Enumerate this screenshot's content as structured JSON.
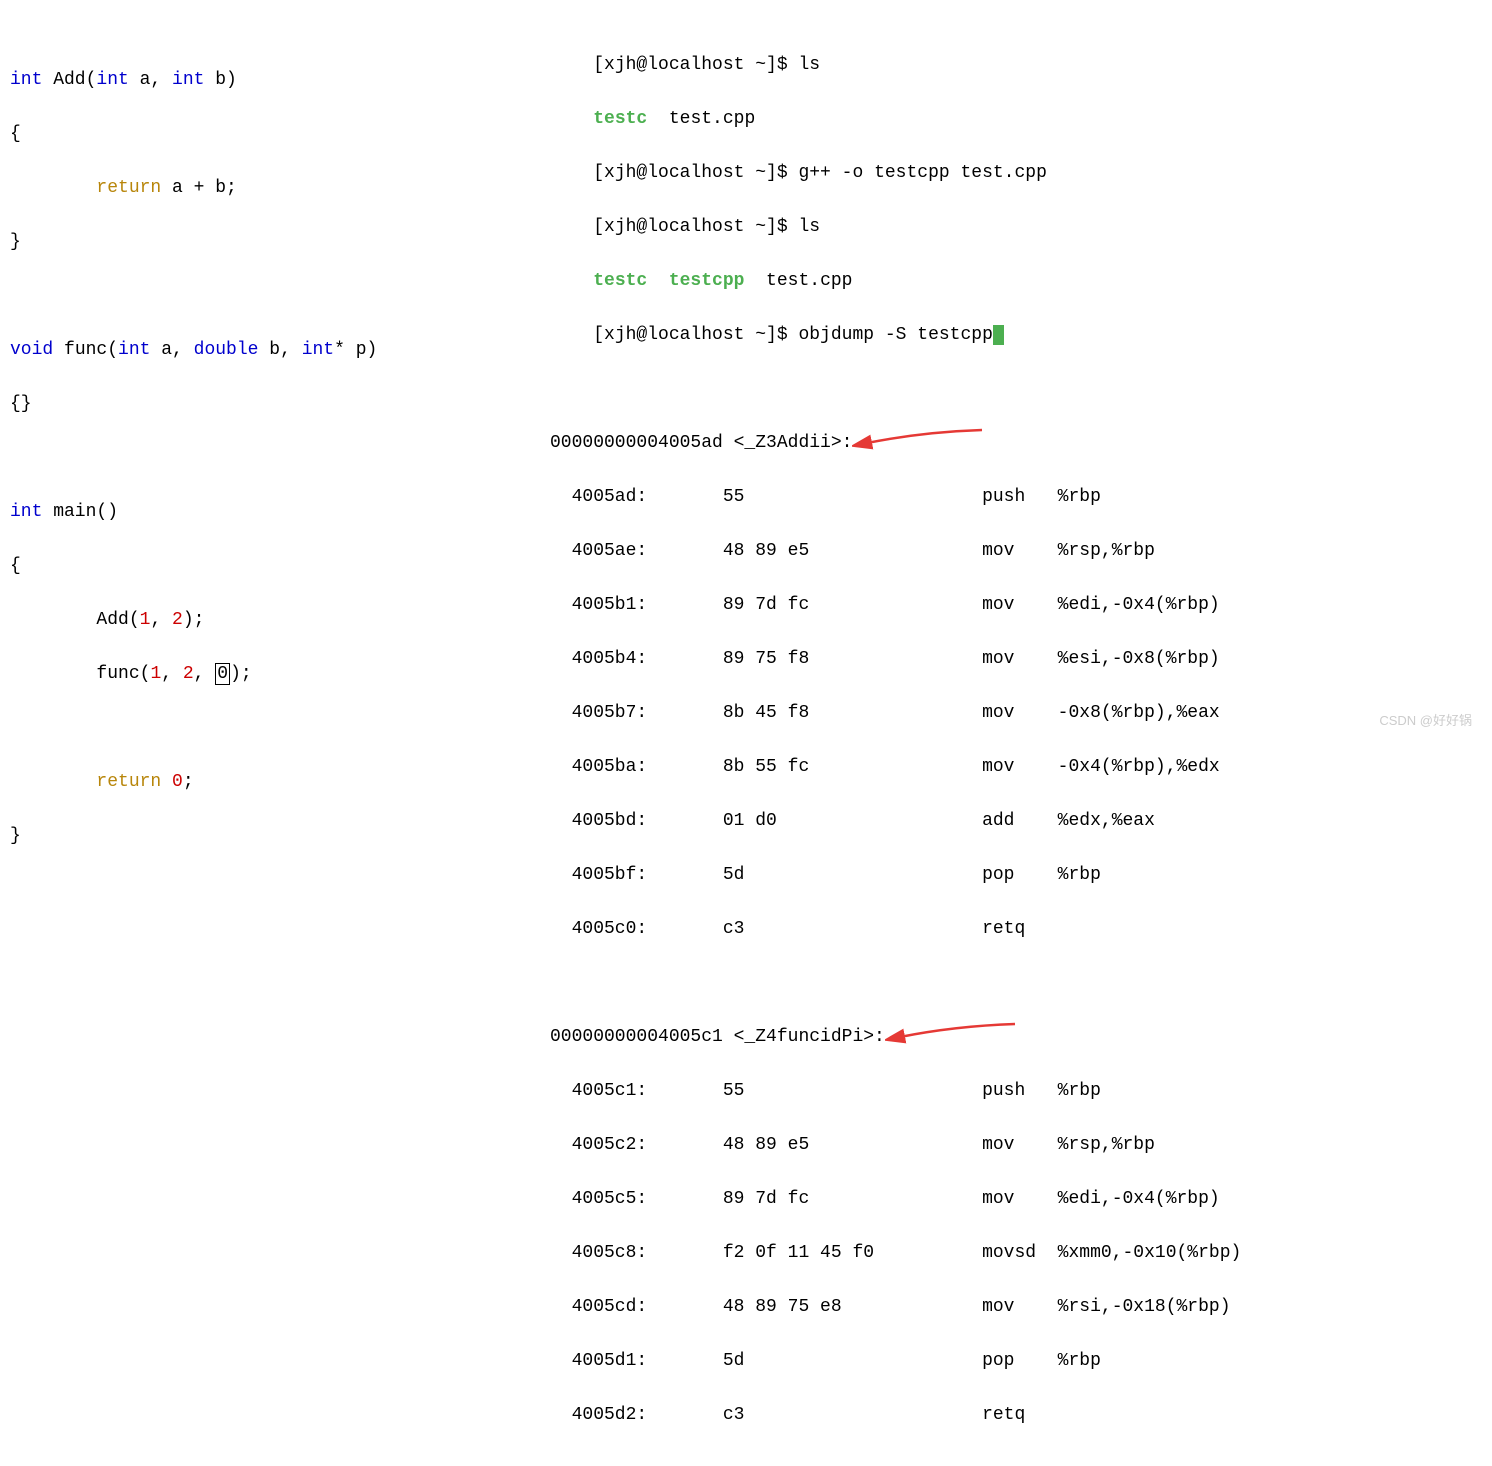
{
  "source": {
    "l1": "int Add(int a, int b)",
    "l2": "{",
    "l3a": "        return",
    "l3b": " a + b;",
    "l4": "}",
    "l5": "void func(int a, double b, int* p)",
    "l6": "{}",
    "l7": "int main()",
    "l8": "{",
    "l9a": "        Add(",
    "l9b": "1",
    "l9c": ", ",
    "l9d": "2",
    "l9e": ");",
    "l10a": "        func(",
    "l10b": "1",
    "l10c": ", ",
    "l10d": "2",
    "l10e": ", ",
    "l10f": "0",
    "l10g": ");",
    "l11a": "        return",
    "l11b": " ",
    "l11c": "0",
    "l11d": ";",
    "l12": "}"
  },
  "term": {
    "p1": "[xjh@localhost ~]$ ls",
    "p2a": "testc",
    "p2b": "  test.cpp",
    "p3": "[xjh@localhost ~]$ g++ -o testcpp test.cpp",
    "p4": "[xjh@localhost ~]$ ls",
    "p5a": "testc  testcpp",
    "p5b": "  test.cpp",
    "p6": "[xjh@localhost ~]$ objdump -S testcpp"
  },
  "asm": {
    "h1": "00000000004005ad <_Z3Addii>:",
    "a1": "  4005ad:       55                      push   %rbp",
    "a2": "  4005ae:       48 89 e5                mov    %rsp,%rbp",
    "a3": "  4005b1:       89 7d fc                mov    %edi,-0x4(%rbp)",
    "a4": "  4005b4:       89 75 f8                mov    %esi,-0x8(%rbp)",
    "a5": "  4005b7:       8b 45 f8                mov    -0x8(%rbp),%eax",
    "a6": "  4005ba:       8b 55 fc                mov    -0x4(%rbp),%edx",
    "a7": "  4005bd:       01 d0                   add    %edx,%eax",
    "a8": "  4005bf:       5d                      pop    %rbp",
    "a9": "  4005c0:       c3                      retq   ",
    "h2": "00000000004005c1 <_Z4funcidPi>:",
    "b1": "  4005c1:       55                      push   %rbp",
    "b2": "  4005c2:       48 89 e5                mov    %rsp,%rbp",
    "b3": "  4005c5:       89 7d fc                mov    %edi,-0x4(%rbp)",
    "b4": "  4005c8:       f2 0f 11 45 f0          movsd  %xmm0,-0x10(%rbp)",
    "b5": "  4005cd:       48 89 75 e8             mov    %rsi,-0x18(%rbp)",
    "b6": "  4005d1:       5d                      pop    %rbp",
    "b7": "  4005d2:       c3                      retq   "
  },
  "watermark": "CSDN @好好锅"
}
